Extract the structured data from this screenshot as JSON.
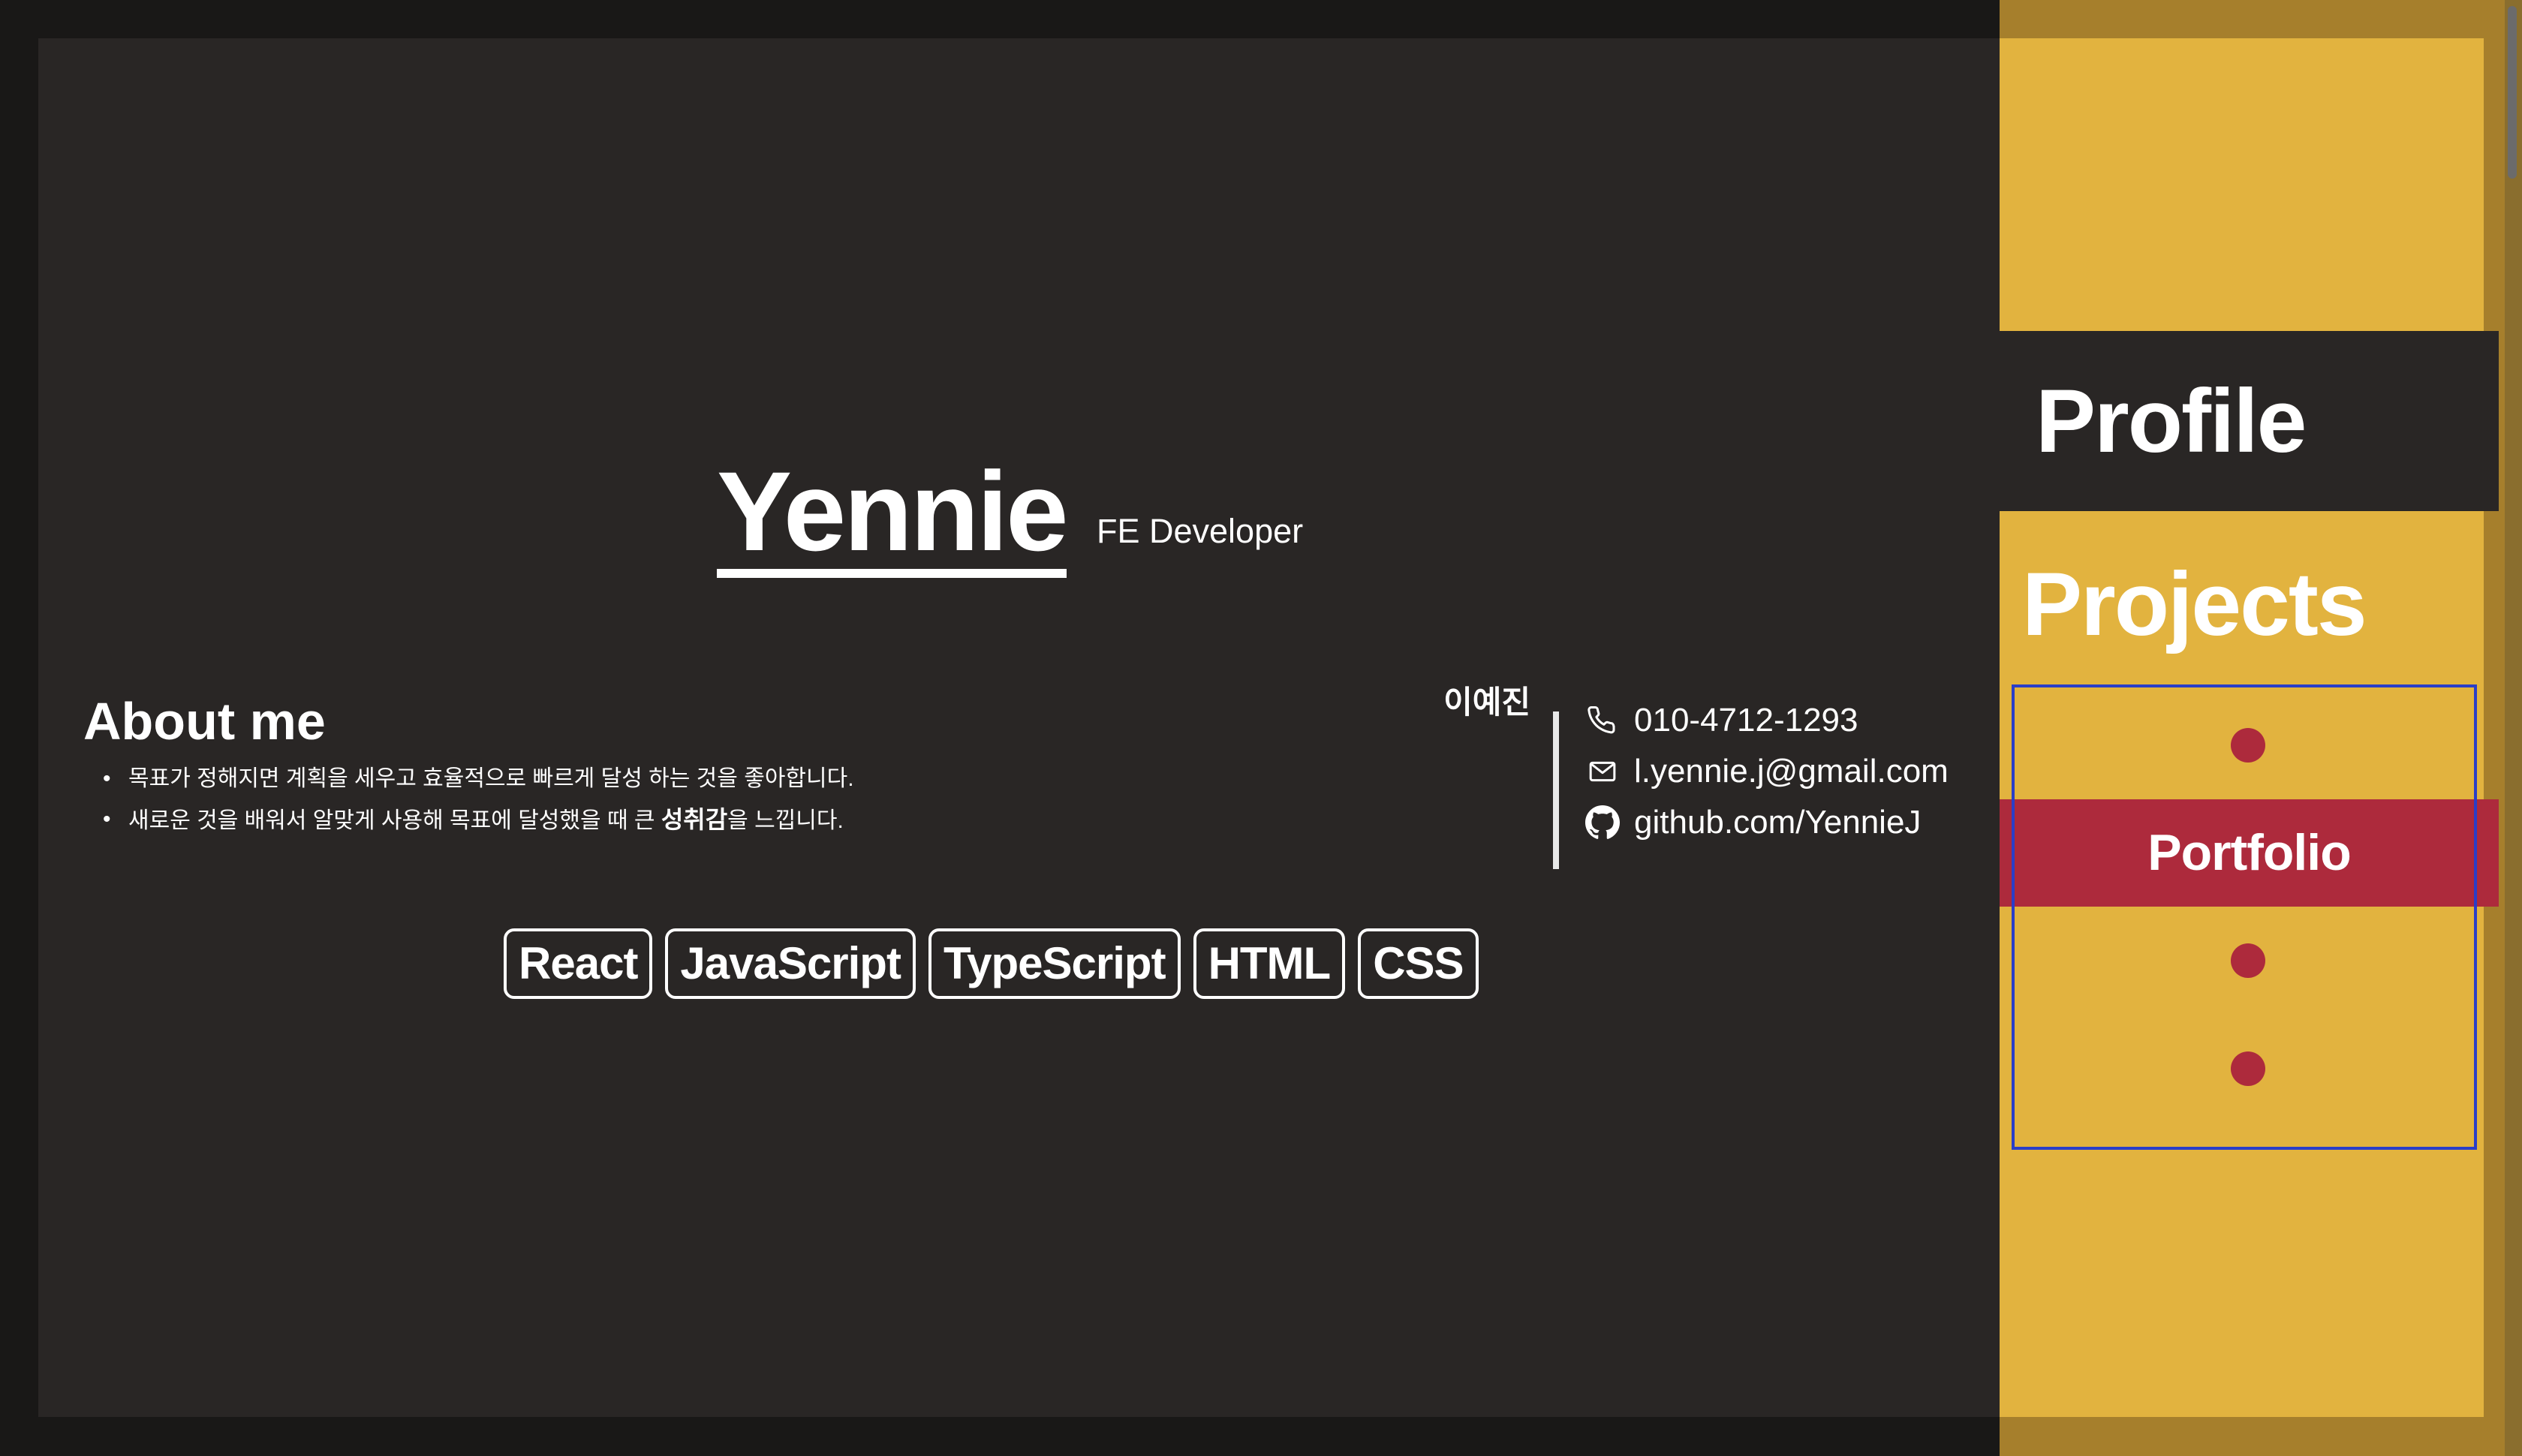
{
  "header": {
    "name": "Yennie",
    "role": "FE Developer"
  },
  "about": {
    "title": "About me",
    "items": [
      {
        "text": "목표가 정해지면 계획을 세우고 효율적으로 빠르게 달성 하는 것을 좋아합니다."
      },
      {
        "before": "새로운 것을 배워서 알맞게 사용해 목표에 달성했을 때 큰 ",
        "bold": "성취감",
        "after": "을 느낍니다."
      }
    ]
  },
  "contact": {
    "korean_name": "이예진",
    "phone": "010-4712-1293",
    "email": "l.yennie.j@gmail.com",
    "github": "github.com/YennieJ",
    "icons": [
      "phone-icon",
      "mail-icon",
      "github-icon"
    ]
  },
  "skills": [
    "React",
    "JavaScript",
    "TypeScript",
    "HTML",
    "CSS"
  ],
  "sidebar": {
    "profile": "Profile",
    "projects": "Projects",
    "portfolio": "Portfolio",
    "colors": {
      "yellow": "#e2b33f",
      "dark": "#292625",
      "red": "#ad2a3c",
      "selection_border": "#2a3ec8"
    }
  }
}
